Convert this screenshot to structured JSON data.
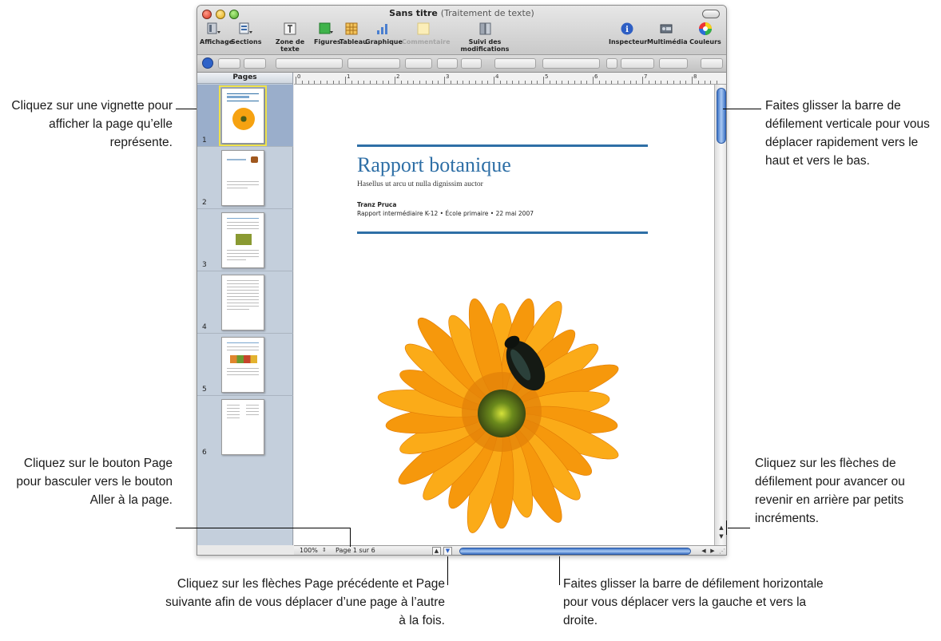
{
  "window": {
    "title": "Sans titre",
    "title_suffix": "(Traitement de texte)"
  },
  "toolbar": {
    "items": [
      {
        "label": "Affichage",
        "icon": "view-icon"
      },
      {
        "label": "Sections",
        "icon": "sections-icon"
      },
      {
        "label": "Zone de texte",
        "icon": "textbox-icon"
      },
      {
        "label": "Figures",
        "icon": "shapes-icon"
      },
      {
        "label": "Tableau",
        "icon": "table-icon"
      },
      {
        "label": "Graphique",
        "icon": "chart-icon"
      },
      {
        "label": "Commentaire",
        "icon": "comment-icon"
      },
      {
        "label": "Suivi des modifications",
        "icon": "track-changes-icon"
      },
      {
        "label": "Inspecteur",
        "icon": "inspector-icon"
      },
      {
        "label": "Multimédia",
        "icon": "media-icon"
      },
      {
        "label": "Couleurs",
        "icon": "colors-icon"
      }
    ]
  },
  "sidebar": {
    "header": "Pages",
    "thumbnails": [
      "1",
      "2",
      "3",
      "4",
      "5",
      "6"
    ]
  },
  "ruler": {
    "numbers": [
      "0",
      "1",
      "2",
      "3",
      "4",
      "5",
      "6",
      "7",
      "8"
    ]
  },
  "document": {
    "title": "Rapport botanique",
    "subtitle": "Hasellus ut arcu ut nulla dignissim auctor",
    "author": "Tranz Pruca",
    "meta": "Rapport intermédiaire K-12 • École primaire • 22 mai 2007"
  },
  "statusbar": {
    "zoom": "100%",
    "page": "Page 1 sur 6"
  },
  "callouts": {
    "thumbnail": "Cliquez sur une vignette pour afficher la page qu’elle représente.",
    "page_button": "Cliquez sur le bouton Page pour basculer vers le bouton Aller à la page.",
    "page_arrows": "Cliquez sur les flèches Page précédente et Page suivante afin de vous déplacer d’une page à l’autre à la fois.",
    "vscroll": "Faites glisser la barre de défilement verticale pour vous déplacer rapidement vers le haut et vers le bas.",
    "scroll_arrows": "Cliquez sur les flèches de défilement pour avancer ou revenir en arrière par petits incréments.",
    "hscroll": "Faites glisser la barre de défilement horizontale pour vous déplacer vers la gauche et vers la droite."
  },
  "colors": {
    "accent": "#2e6fa6",
    "scroll": "#3e74c6",
    "sidebar": "#c4cfdc"
  }
}
